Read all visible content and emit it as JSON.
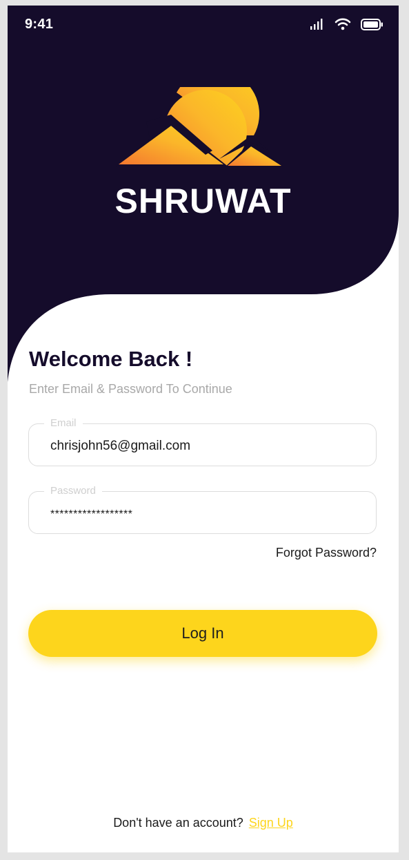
{
  "status_bar": {
    "time": "9:41"
  },
  "brand": {
    "name": "SHRUWAT"
  },
  "form": {
    "title": "Welcome Back !",
    "subtitle": "Enter Email & Password To Continue",
    "email": {
      "label": "Email",
      "value": "chrisjohn56@gmail.com"
    },
    "password": {
      "label": "Password",
      "value": "******************"
    },
    "forgot_label": "Forgot Password?",
    "login_label": "Log In"
  },
  "footer": {
    "prompt": "Don't have an account?",
    "signup_label": "Sign Up"
  },
  "colors": {
    "dark": "#150c2b",
    "accent": "#fdd51c",
    "logo_orange": "#f57d3a"
  }
}
